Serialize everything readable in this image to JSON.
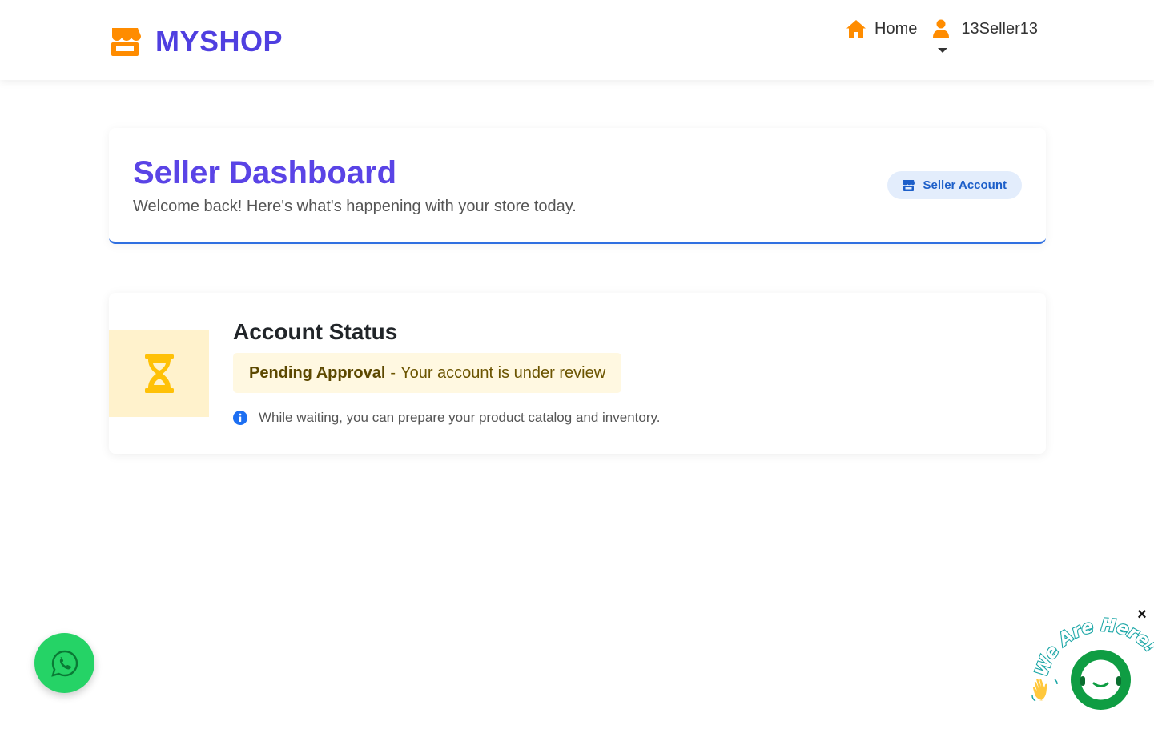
{
  "brand": {
    "name": "MYSHOP",
    "icon": "store-icon",
    "color": "#4f3fe0",
    "icon_color": "#ff8c00"
  },
  "nav": {
    "home_label": "Home",
    "home_icon": "home-icon",
    "user_label": "13Seller13",
    "user_icon": "user-icon"
  },
  "header": {
    "title": "Seller Dashboard",
    "subtitle": "Welcome back! Here's what's happening with your store today.",
    "badge_label": "Seller Account",
    "badge_icon": "store-icon",
    "accent": "#2f6fe0"
  },
  "status": {
    "title": "Account Status",
    "icon": "hourglass-icon",
    "status_label": "Pending Approval",
    "separator": "-",
    "status_message": "Your account is under review",
    "note": "While waiting, you can prepare your product catalog and inventory.",
    "note_icon": "info-icon",
    "status_color": "#ffc107"
  },
  "widgets": {
    "whatsapp_icon": "whatsapp-icon",
    "chat_tagline": "We Are Here!",
    "chat_icon": "chat-icon",
    "close_label": "×"
  }
}
